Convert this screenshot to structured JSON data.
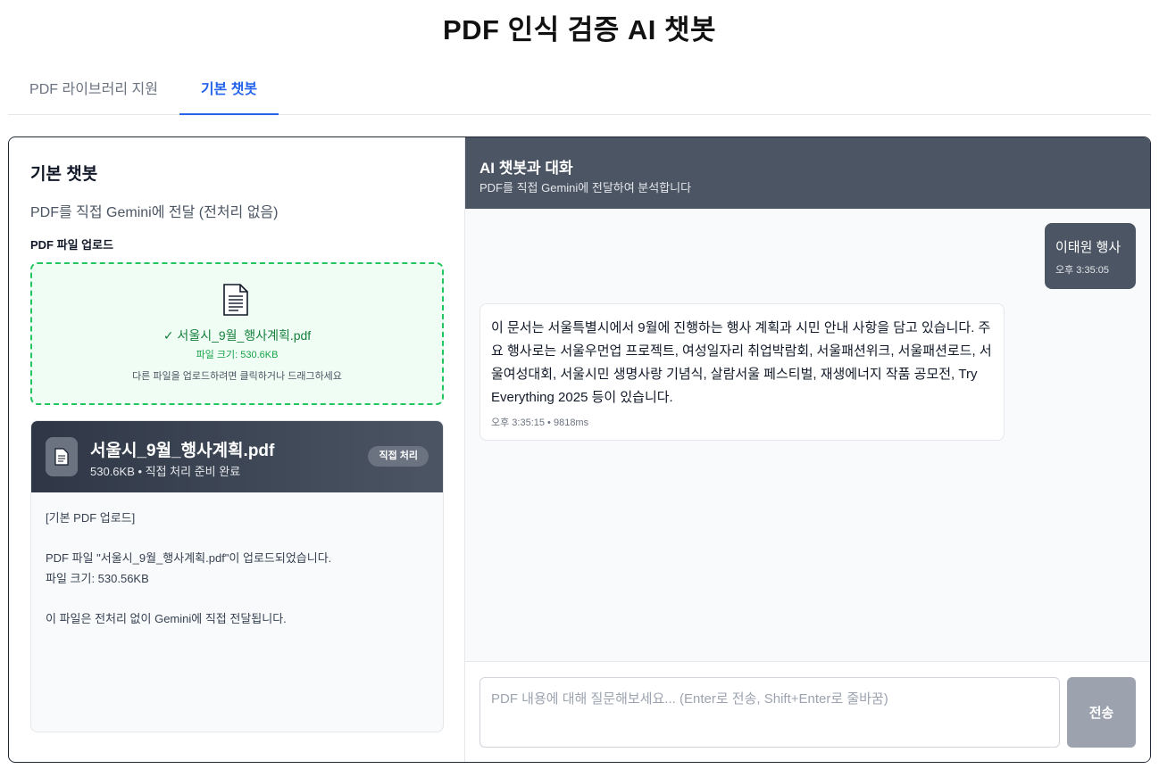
{
  "page": {
    "title": "PDF 인식 검증 AI 챗봇"
  },
  "tabs": [
    {
      "label": "PDF 라이브러리 지원",
      "active": false
    },
    {
      "label": "기본 챗봇",
      "active": true
    }
  ],
  "left": {
    "title": "기본 챗봇",
    "subtitle": "PDF를 직접 Gemini에 전달 (전처리 없음)",
    "upload_label": "PDF 파일 업로드",
    "dropzone": {
      "icon": "document-icon",
      "filename": "✓ 서울시_9월_행사계획.pdf",
      "size": "파일 크기: 530.6KB",
      "hint": "다른 파일을 업로드하려면 클릭하거나 드래그하세요"
    },
    "file_card": {
      "icon": "document-icon",
      "name": "서울시_9월_행사계획.pdf",
      "meta": "530.6KB • 직접 처리 준비 완료",
      "badge": "직접 처리",
      "body_lines": [
        "[기본 PDF 업로드]",
        "PDF 파일 \"서울시_9월_행사계획.pdf\"이 업로드되었습니다.",
        "파일 크기: 530.56KB",
        "이 파일은 전처리 없이 Gemini에 직접 전달됩니다."
      ]
    }
  },
  "chat": {
    "title": "AI 챗봇과 대화",
    "subtitle": "PDF를 직접 Gemini에 전달하여 분석합니다",
    "messages": [
      {
        "role": "user",
        "text": "이태원 행사",
        "time": "오후 3:35:05"
      },
      {
        "role": "assistant",
        "text": "이 문서는 서울특별시에서 9월에 진행하는 행사 계획과 시민 안내 사항을 담고 있습니다. 주요 행사로는 서울우먼업 프로젝트, 여성일자리 취업박람회, 서울패션위크, 서울패션로드, 서울여성대회, 서울시민 생명사랑 기념식, 살람서울 페스티벌, 재생에너지 작품 공모전, Try Everything 2025 등이 있습니다.",
        "time": "오후 3:35:15 • 9818ms"
      }
    ],
    "input_placeholder": "PDF 내용에 대해 질문해보세요... (Enter로 전송, Shift+Enter로 줄바꿈)",
    "input_value": "",
    "send_label": "전송"
  },
  "colors": {
    "accent": "#2563eb",
    "success": "#22c55e",
    "header_dark": "#4b5563",
    "send_disabled": "#9ca3af"
  }
}
